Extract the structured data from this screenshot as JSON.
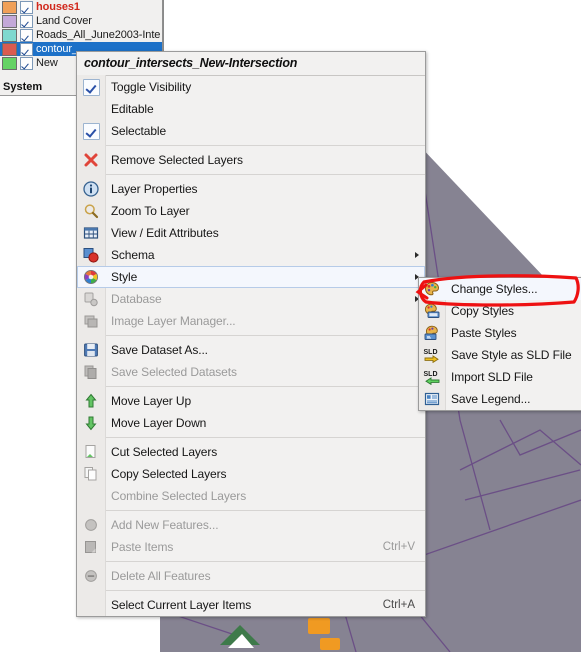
{
  "app": {
    "layer_tree": {
      "system_label": "System",
      "layers": [
        {
          "name": "houses1",
          "color": "#f0a058",
          "checked": true,
          "selected": false,
          "style": "bold-red"
        },
        {
          "name": "Land Cover",
          "color": "#c3a8d8",
          "checked": true,
          "selected": false,
          "style": "normal"
        },
        {
          "name": "Roads_All_June2003-Inte",
          "color": "#7fd8cf",
          "checked": true,
          "selected": false,
          "style": "normal"
        },
        {
          "name": "contour_",
          "color": "#d95b50",
          "checked": true,
          "selected": true,
          "style": "normal"
        },
        {
          "name": "New",
          "color": "#65d265",
          "checked": true,
          "selected": false,
          "style": "normal"
        }
      ]
    },
    "context_menu": {
      "title": "contour_intersects_New-Intersection",
      "groups": [
        {
          "items": [
            {
              "label": "Toggle Visibility",
              "icon": "checkbox-checked-icon",
              "checked": true,
              "enabled": true,
              "shortcut": "",
              "submenu": false
            },
            {
              "label": "Editable",
              "icon": "checkbox-blank-icon",
              "checked": false,
              "enabled": true,
              "shortcut": "",
              "submenu": false
            },
            {
              "label": "Selectable",
              "icon": "checkbox-checked-icon",
              "checked": true,
              "enabled": true,
              "shortcut": "",
              "submenu": false
            }
          ]
        },
        {
          "items": [
            {
              "label": "Remove Selected Layers",
              "icon": "red-x-icon",
              "enabled": true,
              "shortcut": "",
              "submenu": false
            }
          ]
        },
        {
          "items": [
            {
              "label": "Layer Properties",
              "icon": "info-icon",
              "enabled": true,
              "shortcut": "",
              "submenu": false
            },
            {
              "label": "Zoom To Layer",
              "icon": "magnifier-icon",
              "enabled": true,
              "shortcut": "",
              "submenu": false
            },
            {
              "label": "View / Edit Attributes",
              "icon": "table-grid-icon",
              "enabled": true,
              "shortcut": "",
              "submenu": false
            },
            {
              "label": "Schema",
              "icon": "schema-icon",
              "enabled": true,
              "shortcut": "",
              "submenu": true
            },
            {
              "label": "Style",
              "icon": "color-wheel-icon",
              "enabled": true,
              "shortcut": "",
              "submenu": true,
              "highlighted": true
            },
            {
              "label": "Database",
              "icon": "database-gear-icon",
              "enabled": false,
              "shortcut": "",
              "submenu": true
            },
            {
              "label": "Image Layer Manager...",
              "icon": "image-layers-icon",
              "enabled": false,
              "shortcut": "",
              "submenu": false
            }
          ]
        },
        {
          "items": [
            {
              "label": "Save Dataset As...",
              "icon": "floppy-save-icon",
              "enabled": true,
              "shortcut": "",
              "submenu": false
            },
            {
              "label": "Save Selected Datasets",
              "icon": "copy-pages-icon",
              "enabled": false,
              "shortcut": "",
              "submenu": false
            }
          ]
        },
        {
          "items": [
            {
              "label": "Move Layer Up",
              "icon": "arrow-up-icon",
              "enabled": true,
              "shortcut": "",
              "submenu": false
            },
            {
              "label": "Move Layer Down",
              "icon": "arrow-down-icon",
              "enabled": true,
              "shortcut": "",
              "submenu": false
            }
          ]
        },
        {
          "items": [
            {
              "label": "Cut Selected Layers",
              "icon": "cut-page-icon",
              "enabled": true,
              "shortcut": "",
              "submenu": false
            },
            {
              "label": "Copy Selected Layers",
              "icon": "copy-page-icon",
              "enabled": true,
              "shortcut": "",
              "submenu": false
            },
            {
              "label": "Combine Selected Layers",
              "icon": "none",
              "enabled": false,
              "shortcut": "",
              "submenu": false
            }
          ]
        },
        {
          "items": [
            {
              "label": "Add New Features...",
              "icon": "add-feature-icon",
              "enabled": false,
              "shortcut": "",
              "submenu": false
            },
            {
              "label": "Paste Items",
              "icon": "paste-icon",
              "enabled": false,
              "shortcut": "Ctrl+V",
              "submenu": false
            }
          ]
        },
        {
          "items": [
            {
              "label": "Delete All Features",
              "icon": "delete-feature-icon",
              "enabled": false,
              "shortcut": "",
              "submenu": false
            }
          ]
        },
        {
          "items": [
            {
              "label": "Select Current Layer Items",
              "icon": "none",
              "enabled": true,
              "shortcut": "Ctrl+A",
              "submenu": false
            }
          ]
        }
      ]
    },
    "style_submenu": {
      "items": [
        {
          "label": "Change Styles...",
          "icon": "palette-icon",
          "highlighted": true
        },
        {
          "label": "Copy Styles",
          "icon": "palette-copy-icon",
          "highlighted": false
        },
        {
          "label": "Paste Styles",
          "icon": "palette-paste-icon",
          "highlighted": false
        },
        {
          "label": "Save Style as SLD File",
          "icon": "sld-export-icon",
          "highlighted": false
        },
        {
          "label": "Import SLD File",
          "icon": "sld-import-icon",
          "highlighted": false
        },
        {
          "label": "Save Legend...",
          "icon": "legend-icon",
          "highlighted": false
        }
      ]
    },
    "annotation": {
      "shape": "red-hand-drawn-rectangle",
      "color": "#ee1111",
      "target": "Change Styles..."
    },
    "map": {
      "background_color": "#ffffff",
      "polygon_fill": "#868392",
      "road_color": "#6b4f86",
      "building_color": "#f09a22",
      "green_patch": "#3e7a4a"
    }
  }
}
